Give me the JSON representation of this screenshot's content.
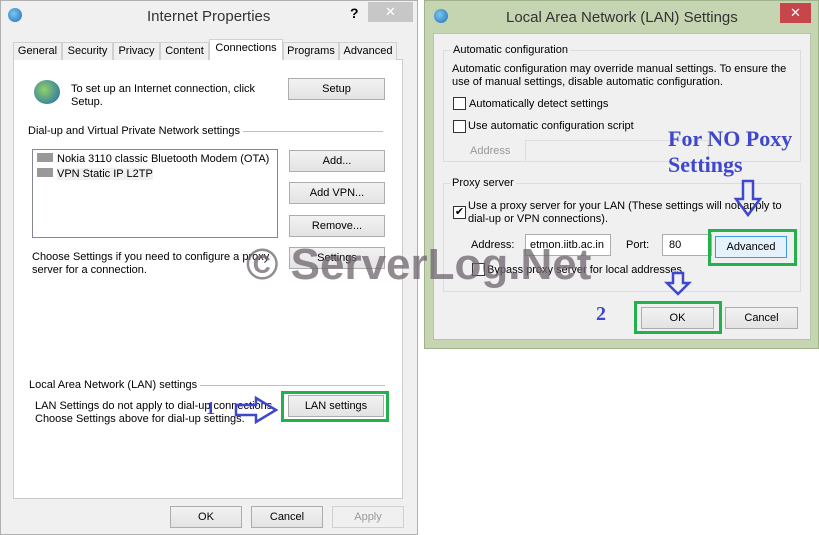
{
  "internet_properties": {
    "title": "Internet Properties",
    "help": "?",
    "close": "✕",
    "tabs": [
      {
        "label": "General"
      },
      {
        "label": "Security"
      },
      {
        "label": "Privacy"
      },
      {
        "label": "Content"
      },
      {
        "label": "Connections"
      },
      {
        "label": "Programs"
      },
      {
        "label": "Advanced"
      }
    ],
    "active_tab": "Connections",
    "setup_text": "To set up an Internet connection, click Setup.",
    "setup_button": "Setup",
    "dialup_group": "Dial-up and Virtual Private Network settings",
    "connections": [
      {
        "label": "Nokia 3110 classic Bluetooth Modem (OTA)"
      },
      {
        "label": "VPN Static IP L2TP"
      }
    ],
    "add_button": "Add...",
    "add_vpn_button": "Add VPN...",
    "remove_button": "Remove...",
    "settings_text": "Choose Settings if you need to configure a proxy server for a connection.",
    "settings_button": "Settings",
    "lan_group": "Local Area Network (LAN) settings",
    "lan_text1": "LAN Settings do not apply to dial-up connections.",
    "lan_text2": "Choose Settings above for dial-up settings.",
    "lan_button": "LAN settings",
    "ok": "OK",
    "cancel": "Cancel",
    "apply": "Apply"
  },
  "lan_settings": {
    "title": "Local Area Network (LAN) Settings",
    "close": "✕",
    "auto_group": "Automatic configuration",
    "auto_text": "Automatic configuration may override manual settings.  To ensure the use of manual settings, disable automatic configuration.",
    "auto_detect": {
      "label": "Automatically detect settings",
      "checked": false
    },
    "auto_script": {
      "label": "Use automatic configuration script",
      "checked": false
    },
    "script_address_label": "Address",
    "script_address_value": "",
    "proxy_group": "Proxy server",
    "use_proxy": {
      "label": "Use a proxy server for your LAN (These settings will not apply to dial-up or VPN connections).",
      "checked": true
    },
    "address_label": "Address:",
    "address_value": "etmon.iitb.ac.in",
    "port_label": "Port:",
    "port_value": "80",
    "advanced_button": "Advanced",
    "bypass": {
      "label": "Bypass proxy server for local addresses",
      "checked": false
    },
    "ok": "OK",
    "cancel": "Cancel"
  },
  "annotations": {
    "step1": "1",
    "step2": "2",
    "no_proxy": "For NO Poxy Settings",
    "watermark": "© ServerLog.Net",
    "highlight_color": "#22b14c",
    "arrow_color": "#3f48cc"
  }
}
